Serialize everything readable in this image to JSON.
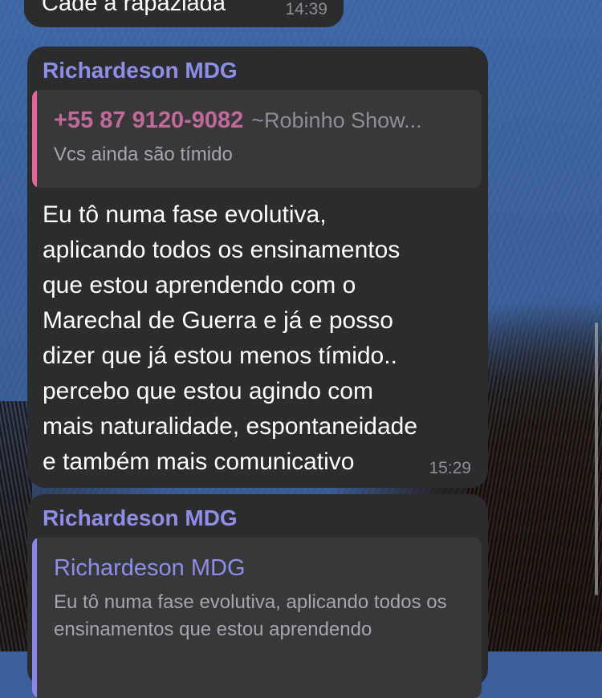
{
  "messages": [
    {
      "text": "Cade a rapaziada",
      "time": "14:39"
    },
    {
      "sender": "Richardeson MDG",
      "reply": {
        "name": "+55 87 9120-9082",
        "alias": "~Robinho Show...",
        "text": "Vcs ainda são tímido"
      },
      "text": "Eu tô numa fase evolutiva,\naplicando todos os ensinamentos\nque estou aprendendo com o\nMarechal de  Guerra e já e posso\ndizer que já estou menos tímido..\npercebo que estou agindo com\nmais naturalidade, espontaneidade\ne também mais comunicativo",
      "time": "15:29"
    },
    {
      "sender": "Richardeson MDG",
      "reply": {
        "name": "Richardeson MDG",
        "text": "Eu tô numa fase evolutiva, aplicando todos os ensinamentos que estou aprendendo"
      }
    }
  ],
  "colors": {
    "bubble": "#2c2c2f",
    "sender": "#8f8ee6",
    "reply_bar_pink": "#e0679c",
    "reply_bar_purple": "#8a88e6",
    "wallpaper": "#3a5f9a"
  }
}
